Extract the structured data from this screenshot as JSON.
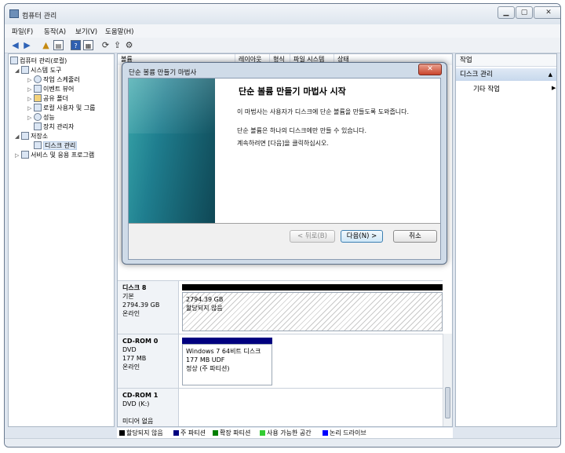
{
  "window": {
    "title": "컴퓨터 관리",
    "controls": {
      "minimize": "▁",
      "maximize": "▢",
      "close": "✕"
    }
  },
  "menubar": [
    "파일(F)",
    "동작(A)",
    "보기(V)",
    "도움말(H)"
  ],
  "toolbar": {
    "icons": [
      "back-icon",
      "forward-icon",
      "up-icon",
      "show-hide-tree-icon",
      "help-icon",
      "properties-icon",
      "refresh-icon",
      "export-icon",
      "settings-icon"
    ]
  },
  "tree": {
    "items": [
      {
        "label": "컴퓨터 관리(로컬)",
        "expander": "",
        "icon": "computer-icon"
      },
      {
        "label": "시스템 도구",
        "expander": "◢",
        "icon": "tools-icon"
      },
      {
        "label": "작업 스케줄러",
        "expander": "▷",
        "icon": "scheduler-icon"
      },
      {
        "label": "이벤트 뷰어",
        "expander": "▷",
        "icon": "event-viewer-icon"
      },
      {
        "label": "공유 폴더",
        "expander": "▷",
        "icon": "shared-folder-icon"
      },
      {
        "label": "로컬 사용자 및 그룹",
        "expander": "▷",
        "icon": "users-icon"
      },
      {
        "label": "성능",
        "expander": "▷",
        "icon": "performance-icon"
      },
      {
        "label": "장치 관리자",
        "expander": "",
        "icon": "device-manager-icon"
      },
      {
        "label": "저장소",
        "expander": "◢",
        "icon": "storage-icon"
      },
      {
        "label": "디스크 관리",
        "expander": "",
        "icon": "disk-management-icon"
      },
      {
        "label": "서비스 및 응용 프로그램",
        "expander": "▷",
        "icon": "services-icon"
      }
    ]
  },
  "columns": [
    "볼륨",
    "레이아웃",
    "형식",
    "파일 시스템",
    "상태"
  ],
  "disks": [
    {
      "name": "디스크 8",
      "type": "기본",
      "size": "2794.39 GB",
      "state": "온라인",
      "partitions": [
        {
          "size": "2794.39 GB",
          "status": "할당되지 않음"
        }
      ]
    },
    {
      "name": "CD-ROM 0",
      "type": "DVD",
      "size": "177 MB",
      "state": "온라인",
      "partitions": [
        {
          "title": "Windows 7 64비트 디스크",
          "size": "177 MB UDF",
          "status": "정상 (주 파티션)"
        }
      ]
    },
    {
      "name": "CD-ROM 1",
      "type": "DVD (K:)",
      "size": "",
      "state": "미디어 없음",
      "partitions": []
    }
  ],
  "legend": [
    {
      "label": "할당되지 않음",
      "color": "#000000"
    },
    {
      "label": "주 파티션",
      "color": "#00007f"
    },
    {
      "label": "확장 파티션",
      "color": "#007f00"
    },
    {
      "label": "사용 가능한 공간",
      "color": "#33cc33"
    },
    {
      "label": "논리 드라이브",
      "color": "#0000ff"
    }
  ],
  "actions": {
    "header": "작업",
    "section": "디스크 관리",
    "item": "기타 작업"
  },
  "wizard": {
    "title": "단순 볼륨 만들기 마법사",
    "heading": "단순 볼륨 만들기 마법사 시작",
    "para1": "이 마법사는 사용자가 디스크에 단순 볼륨을 만들도록 도와줍니다.",
    "para2": "단순 볼륨은 하나의 디스크에만 만들 수 있습니다.",
    "para3": "계속하려면 [다음]을 클릭하십시오.",
    "buttons": {
      "back": "< 뒤로(B)",
      "next": "다음(N) >",
      "cancel": "취소"
    },
    "close": "✕"
  },
  "colors": {
    "accent": "#3c7fb1",
    "unallocated": "#000000",
    "primary_partition": "#00007f"
  }
}
